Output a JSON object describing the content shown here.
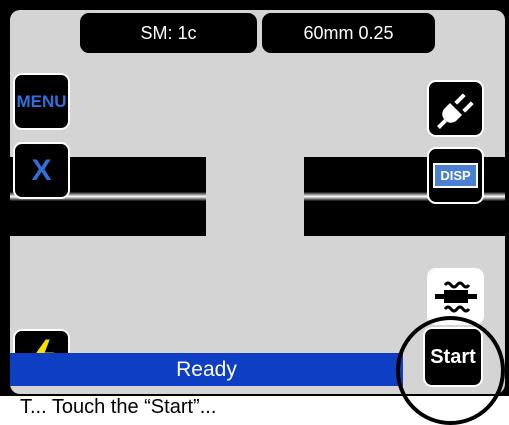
{
  "header": {
    "fiber_mode": "SM: 1c",
    "cleave_setting": "60mm 0.25"
  },
  "buttons": {
    "menu_label": "MENU",
    "cancel_label": "X",
    "disp_label": "DISP",
    "start_label": "Start"
  },
  "status": {
    "text": "Ready"
  },
  "caption": {
    "text": "T...  Touch the “Start”..."
  },
  "icons": {
    "power": "plug-icon",
    "heater": "heater-icon",
    "arc": "lightning-icon"
  },
  "colors": {
    "accent_blue": "#2f6fdc",
    "status_bar": "#0d3ec4",
    "screen_bg": "#d4d4d4",
    "arc_yellow": "#f5e100"
  }
}
